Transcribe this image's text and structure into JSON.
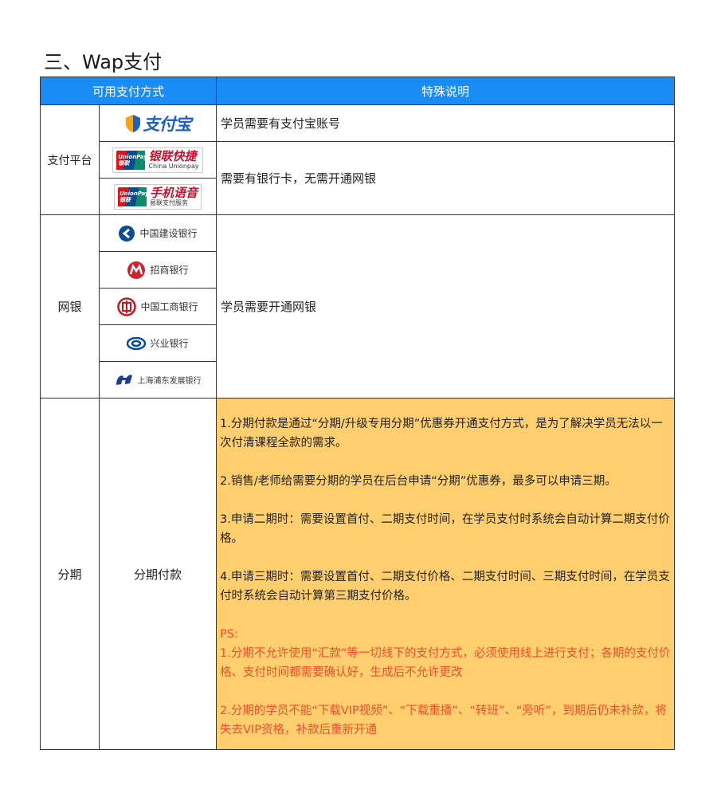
{
  "heading": "三、Wap支付",
  "table": {
    "headers": [
      "可用支付方式",
      "特殊说明"
    ],
    "sections": {
      "platform": {
        "label": "支付平台",
        "logos": {
          "alipay": "支付宝",
          "unionpay_quick": {
            "title": "银联快捷",
            "sub": "China Unionpay",
            "badge": "UnionPay 银联"
          },
          "unionpay_phone": {
            "title": "手机语音",
            "sub": "易联支付服务",
            "badge": "UnionPay 银联"
          }
        },
        "notes": [
          "学员需要有支付宝账号",
          "需要有银行卡，无需开通网银"
        ]
      },
      "netbank": {
        "label": "网银",
        "banks": [
          "中国建设银行",
          "招商银行",
          "中国工商银行",
          "兴业银行",
          "上海浦东发展银行"
        ],
        "note": "学员需要开通网银"
      },
      "installment": {
        "label": "分期",
        "method": "分期付款",
        "paragraphs": [
          "1.分期付款是通过“分期/升级专用分期”优惠券开通支付方式，是为了解决学员无法以一次付清课程全款的需求。",
          "2.销售/老师给需要分期的学员在后台申请“分期”优惠券，最多可以申请三期。",
          "3.申请二期时：需要设置首付、二期支付时间，在学员支付时系统会自动计算二期支付价格。",
          "4.申请三期时：需要设置首付、二期支付价格、二期支付时间、三期支付时间，在学员支付时系统会自动计算第三期支付价格。"
        ],
        "ps_label": "PS:",
        "ps_paragraphs": [
          "1.分期不允许使用“汇款”等一切线下的支付方式，必须使用线上进行支付；各期的支付价格、支付时间都需要确认好，生成后不允许更改",
          "2.分期的学员不能“下载VIP视频”、“下载重播”、“转班”、“旁听”，到期后仍未补款，将失去VIP资格，补款后重新开通"
        ]
      }
    }
  },
  "colors": {
    "header_bg": "#1a8cf5",
    "highlight_bg": "#ffcf6f",
    "ps_text": "#f24d2a",
    "border": "#333333"
  }
}
